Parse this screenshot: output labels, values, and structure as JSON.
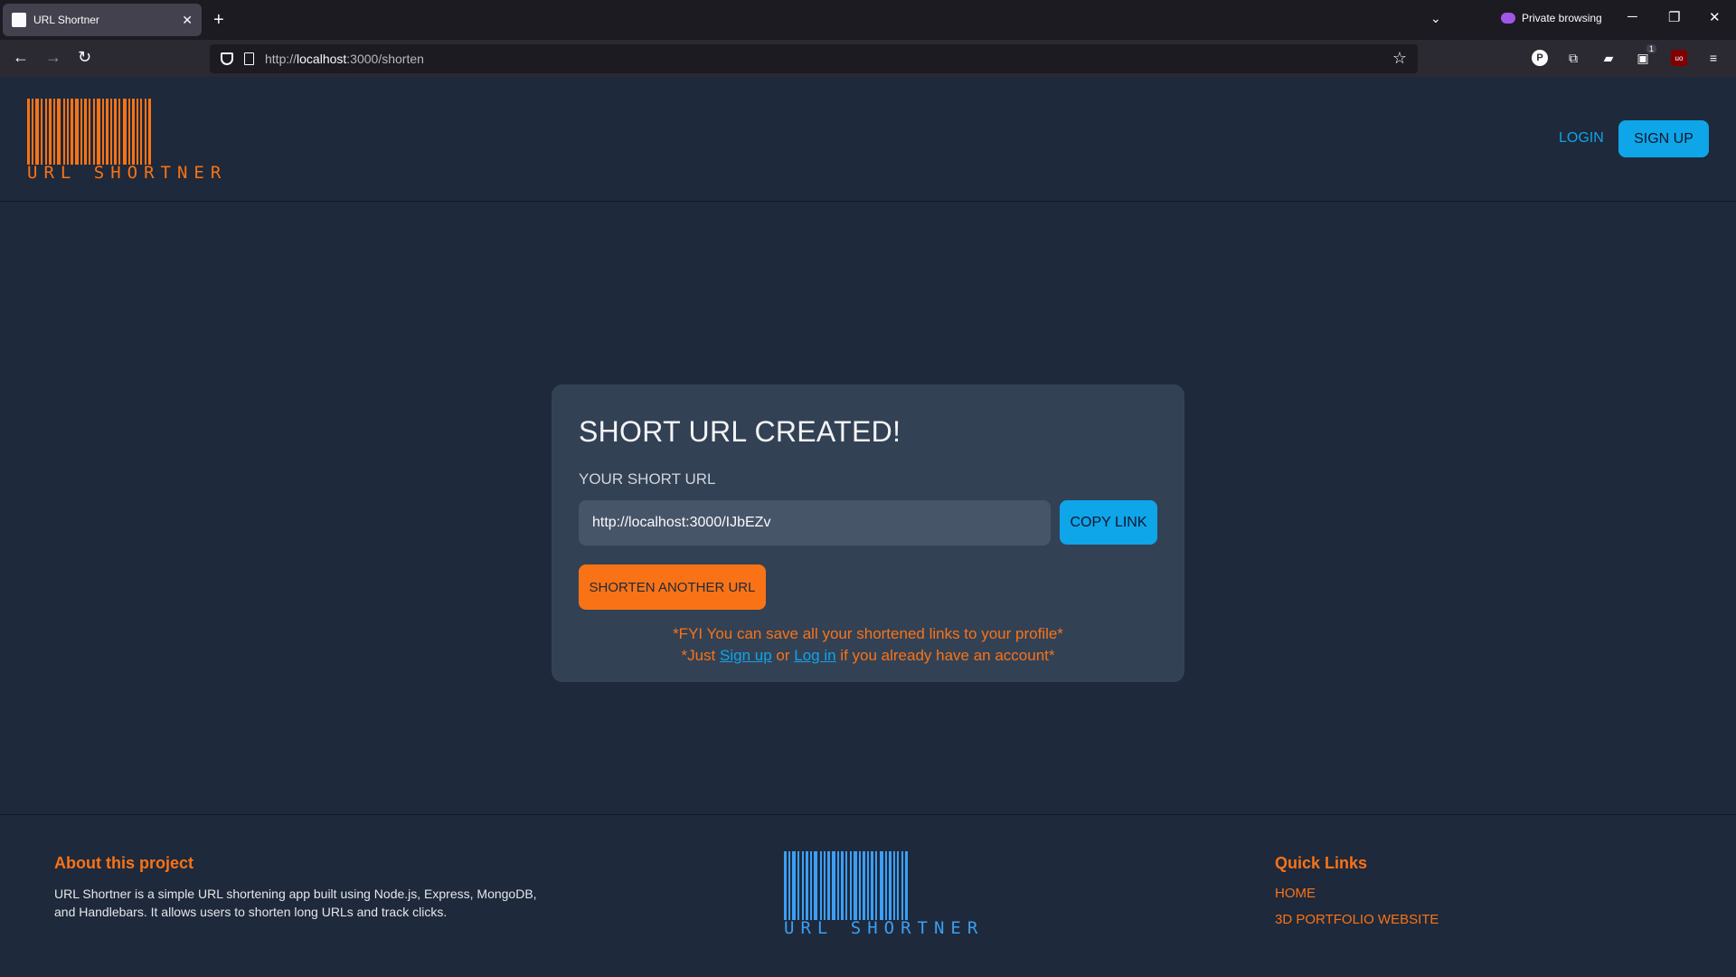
{
  "browser": {
    "tab_title": "URL Shortner",
    "new_tab": "+",
    "private_label": "Private browsing",
    "url_prefix": "http://",
    "url_host": "localhost",
    "url_rest": ":3000/shorten",
    "extension_badge": "1",
    "ext_p": "P",
    "ext_ub": "uo"
  },
  "header": {
    "logo_text": "URL SHORTNER",
    "login_label": "LOGIN",
    "signup_label": "SIGN UP"
  },
  "card": {
    "title": "SHORT URL CREATED!",
    "label": "YOUR SHORT URL",
    "short_url": "http://localhost:3000/IJbEZv",
    "copy_label": "COPY LINK",
    "another_label": "SHORTEN ANOTHER URL",
    "fyi_line1": "*FYI You can save all your shortened links to your profile*",
    "fyi_prefix": "*Just ",
    "fyi_signup": "Sign up",
    "fyi_or": " or ",
    "fyi_login": "Log in",
    "fyi_suffix": " if you already have an account*"
  },
  "footer": {
    "about_title": "About this project",
    "about_text": "URL Shortner is a simple URL shortening app built using Node.js, Express, MongoDB, and Handlebars. It allows users to shorten long URLs and track clicks.",
    "logo_text": "URL SHORTNER",
    "quick_title": "Quick Links",
    "links": [
      "HOME",
      "3D PORTFOLIO WEBSITE"
    ]
  },
  "colors": {
    "accent_orange": "#f97316",
    "accent_blue": "#0ea5e9",
    "footer_logo_blue": "#3b9ff5",
    "page_bg": "#1e293b",
    "card_bg": "#334155"
  }
}
